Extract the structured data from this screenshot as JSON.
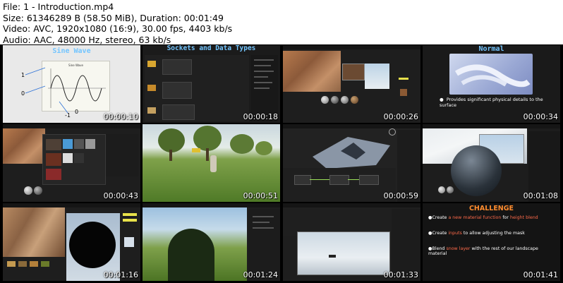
{
  "file_info": {
    "file": "File: 1 - Introduction.mp4",
    "size": "Size: 61346289 B (58.50 MiB), Duration: 00:01:49",
    "video": "Video: AVC, 1920x1080 (16:9), 30.00 fps, 4403 kb/s",
    "audio": "Audio: AAC, 48000 Hz, stereo, 63 kb/s"
  },
  "thumbnails": [
    {
      "timestamp": "00:00:10",
      "title": "Sine Wave",
      "inner_title": "Sine Wave",
      "labels": [
        "1",
        "0",
        "-1",
        "0"
      ]
    },
    {
      "timestamp": "00:00:18",
      "title": "Sockets and Data Types"
    },
    {
      "timestamp": "00:00:26"
    },
    {
      "timestamp": "00:00:34",
      "title": "Normal",
      "bullet": "Provides significant physical details to the surface"
    },
    {
      "timestamp": "00:00:43"
    },
    {
      "timestamp": "00:00:51"
    },
    {
      "timestamp": "00:00:59"
    },
    {
      "timestamp": "00:01:08"
    },
    {
      "timestamp": "00:01:16"
    },
    {
      "timestamp": "00:01:24"
    },
    {
      "timestamp": "00:01:33"
    },
    {
      "timestamp": "00:01:41",
      "title": "CHALLENGE",
      "items": [
        {
          "pre": "Create ",
          "hl": "a new material function",
          "mid": " for ",
          "hl2": "height blend",
          "post": ""
        },
        {
          "pre": "Create ",
          "hl": "inputs",
          "mid": " to allow adjusting the mask",
          "hl2": "",
          "post": ""
        },
        {
          "pre": "Blend ",
          "hl": "snow layer",
          "mid": " with the rest of our landscape material",
          "hl2": "",
          "post": ""
        }
      ]
    }
  ],
  "colors": {
    "slide_blue": "#73c5ff",
    "challenge_orange": "#ff8c2e",
    "highlight_red": "#ff6a4a"
  }
}
